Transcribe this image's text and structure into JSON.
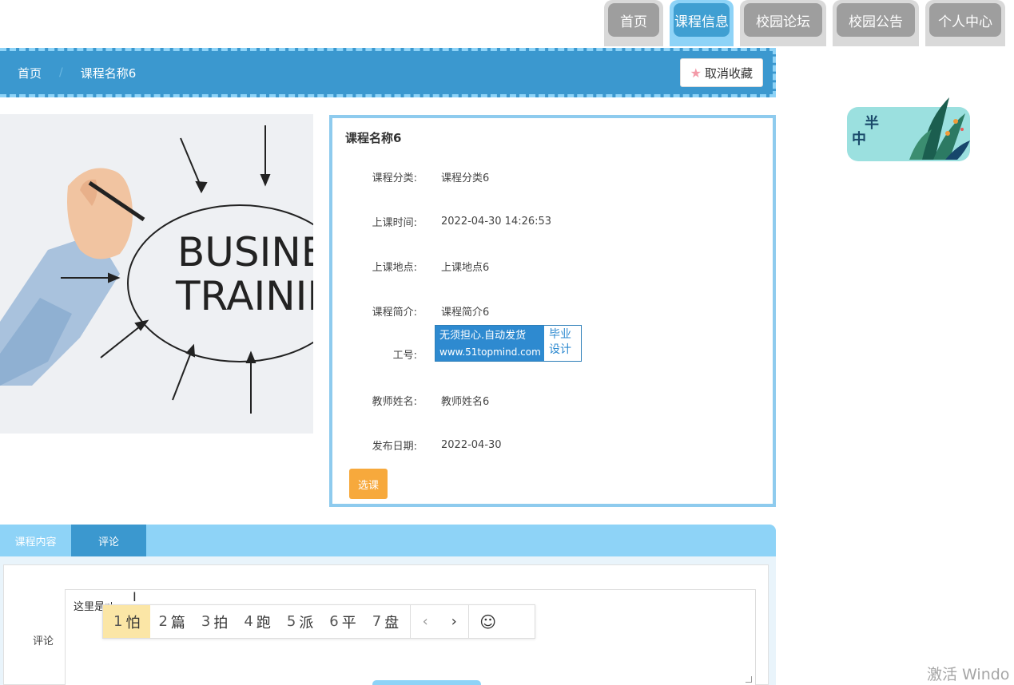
{
  "nav": {
    "tabs": [
      {
        "label": "首页",
        "active": false
      },
      {
        "label": "课程信息",
        "active": true
      },
      {
        "label": "校园论坛",
        "active": false
      },
      {
        "label": "校园公告",
        "active": false
      },
      {
        "label": "个人中心",
        "active": false
      }
    ]
  },
  "breadcrumb": {
    "home": "首页",
    "current": "课程名称6",
    "fav_button": "取消收藏"
  },
  "course_image": {
    "line1": "BUSINES",
    "line2": "TRAININ"
  },
  "detail": {
    "title": "课程名称6",
    "fields": [
      {
        "label": "课程分类:",
        "value": "课程分类6"
      },
      {
        "label": "上课时间:",
        "value": "2022-04-30 14:26:53"
      },
      {
        "label": "上课地点:",
        "value": "上课地点6"
      },
      {
        "label": "课程简介:",
        "value": "课程简介6"
      },
      {
        "label": "工号:",
        "value": ""
      },
      {
        "label": "教师姓名:",
        "value": "教师姓名6"
      },
      {
        "label": "发布日期:",
        "value": "2022-04-30"
      }
    ],
    "badge": {
      "line1": "无须担心.自动发货",
      "line2": "www.51topmind.com",
      "right": "毕业设计"
    },
    "select_button": "选课"
  },
  "logo": {
    "text1": "半",
    "text2": "中"
  },
  "tabs": {
    "content": "课程内容",
    "comment": "评论"
  },
  "comment": {
    "label": "评论",
    "text": "这里是p"
  },
  "ime": {
    "candidates": [
      {
        "num": "1",
        "char": "怕"
      },
      {
        "num": "2",
        "char": "篇"
      },
      {
        "num": "3",
        "char": "拍"
      },
      {
        "num": "4",
        "char": "跑"
      },
      {
        "num": "5",
        "char": "派"
      },
      {
        "num": "6",
        "char": "平"
      },
      {
        "num": "7",
        "char": "盘"
      }
    ],
    "prev": "‹",
    "next": "›",
    "emoji": "☺"
  },
  "watermark": "激活 Windo",
  "colors": {
    "primary": "#3b98cf",
    "light": "#8ed3f7",
    "accent": "#f7a93c"
  }
}
